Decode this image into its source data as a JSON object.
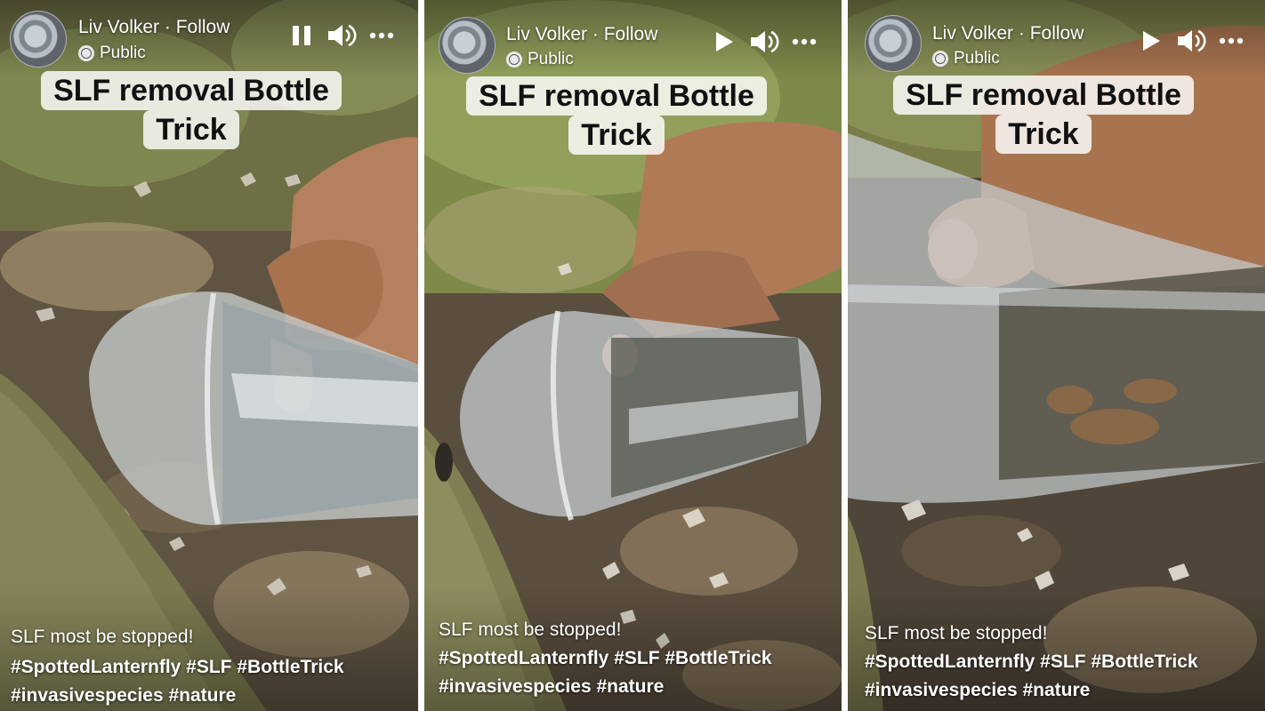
{
  "panels": [
    {
      "author": "Liv Volker",
      "follow_sep": " · ",
      "follow_label": "Follow",
      "audience": "Public",
      "playback_icon": "pause-icon",
      "caption_line1": "SLF removal Bottle",
      "caption_line2": "Trick",
      "description": "SLF most be stopped!",
      "hashtags_line1": "#SpottedLanternfly #SLF #BottleTrick",
      "hashtags_line2": "#invasivespecies #nature"
    },
    {
      "author": "Liv Volker",
      "follow_sep": " · ",
      "follow_label": "Follow",
      "audience": "Public",
      "playback_icon": "play-icon",
      "caption_line1": "SLF removal Bottle",
      "caption_line2": "Trick",
      "description": "SLF most be stopped!",
      "hashtags_line1": "#SpottedLanternfly #SLF #BottleTrick",
      "hashtags_line2": "#invasivespecies #nature"
    },
    {
      "author": "Liv Volker",
      "follow_sep": " · ",
      "follow_label": "Follow",
      "audience": "Public",
      "playback_icon": "play-icon",
      "caption_line1": "SLF removal Bottle",
      "caption_line2": "Trick",
      "description": "SLF most be stopped!",
      "hashtags_line1": "#SpottedLanternfly #SLF #BottleTrick",
      "hashtags_line2": "#invasivespecies #nature"
    }
  ],
  "colors": {
    "caption_bg": "#ffffff",
    "text_on_video": "#ffffff",
    "grass": "#7a8a48",
    "soil": "#5b4a37",
    "bark": "#7c7a52",
    "skin": "#b98360"
  }
}
